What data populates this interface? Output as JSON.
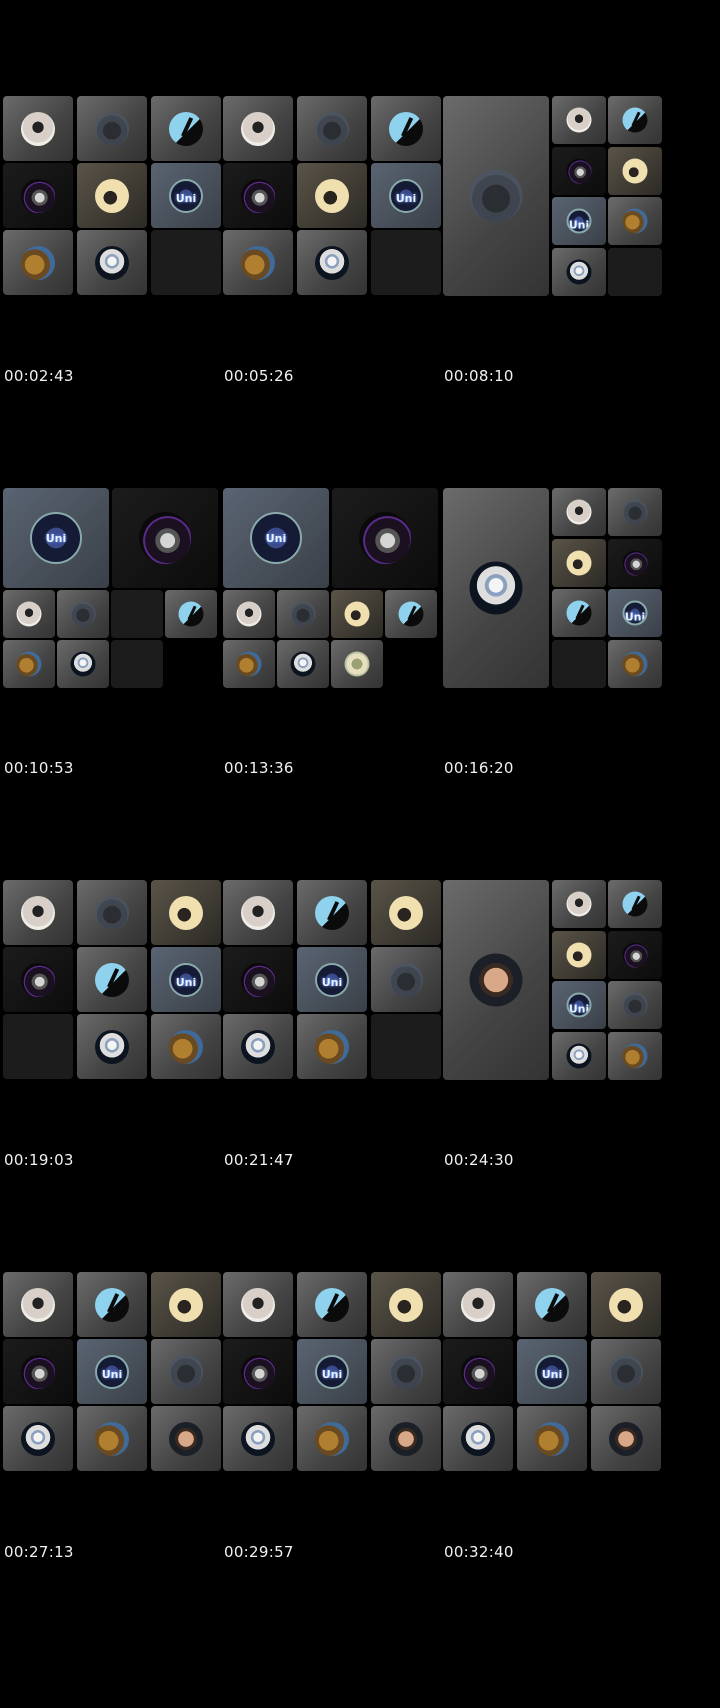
{
  "sheet": {
    "timestamps": [
      "00:02:43",
      "00:05:26",
      "00:08:10",
      "00:10:53",
      "00:13:36",
      "00:16:20",
      "00:19:03",
      "00:21:47",
      "00:24:30",
      "00:27:13",
      "00:29:57",
      "00:32:40"
    ]
  },
  "frames": [
    {
      "layout": "grid3",
      "tiles": [
        "girl",
        "hood",
        "v",
        "skull",
        "mic",
        "uni",
        "dog",
        "astro",
        "empty"
      ]
    },
    {
      "layout": "grid3",
      "tiles": [
        "girl",
        "hood",
        "v",
        "skull",
        "mic",
        "uni",
        "dog",
        "astro",
        "empty"
      ]
    },
    {
      "layout": "spotlight",
      "main": "hood",
      "side": [
        "girl",
        "v",
        "skull",
        "mic",
        "uni",
        "dog",
        "astro",
        "empty"
      ]
    },
    {
      "layout": "top2",
      "top": [
        "uni",
        "skull"
      ],
      "grid": [
        "girl",
        "hood",
        "empty",
        "v",
        "dog",
        "astro",
        "empty"
      ]
    },
    {
      "layout": "top2",
      "top": [
        "uni",
        "skull"
      ],
      "grid": [
        "girl",
        "hood",
        "mic",
        "v",
        "dog",
        "astro",
        "blond"
      ]
    },
    {
      "layout": "spotlight",
      "main": "astro",
      "side": [
        "girl",
        "hood",
        "mic",
        "skull",
        "v",
        "uni",
        "empty",
        "dog"
      ]
    },
    {
      "layout": "grid3",
      "tiles": [
        "girl",
        "hood",
        "mic",
        "skull",
        "v",
        "uni",
        "empty",
        "astro",
        "dog"
      ]
    },
    {
      "layout": "grid3",
      "tiles": [
        "girl",
        "v",
        "mic",
        "skull",
        "uni",
        "hood",
        "astro",
        "dog",
        "empty"
      ]
    },
    {
      "layout": "spotlight",
      "main": "boy",
      "side": [
        "girl",
        "v",
        "mic",
        "skull",
        "uni",
        "hood",
        "astro",
        "dog"
      ]
    },
    {
      "layout": "grid3",
      "tiles": [
        "girl",
        "v",
        "mic",
        "skull",
        "uni",
        "hood",
        "astro",
        "dog",
        "boy"
      ]
    },
    {
      "layout": "grid3",
      "tiles": [
        "girl",
        "v",
        "mic",
        "skull",
        "uni",
        "hood",
        "astro",
        "dog",
        "boy"
      ]
    },
    {
      "layout": "grid3",
      "tiles": [
        "girl",
        "v",
        "mic",
        "skull",
        "uni",
        "hood",
        "astro",
        "dog",
        "boy"
      ]
    }
  ]
}
